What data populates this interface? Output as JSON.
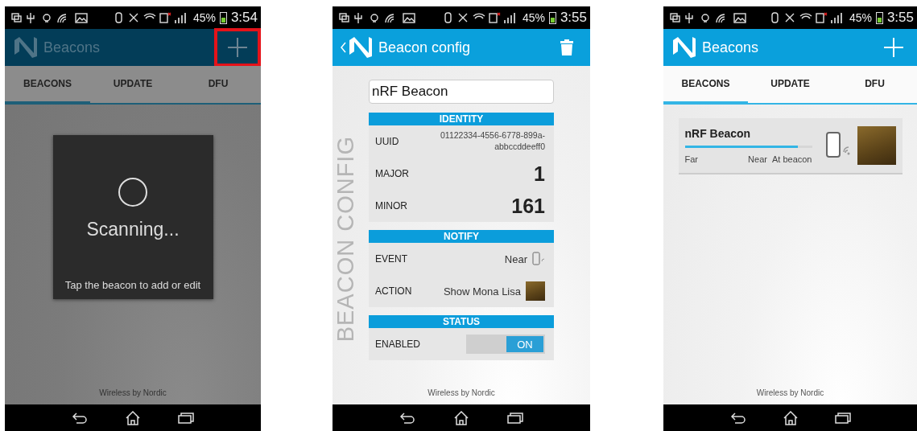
{
  "screens": [
    {
      "kind": "scanning",
      "dimmed": true,
      "status_bar": {
        "battery": "45%",
        "time": "3:54"
      },
      "app_bar": {
        "back": false,
        "title": "Beacons",
        "action": {
          "kind": "add",
          "highlighted": true
        }
      },
      "tabs": [
        {
          "label": "BEACONS",
          "selected": true
        },
        {
          "label": "UPDATE",
          "selected": false
        },
        {
          "label": "DFU",
          "selected": false
        }
      ],
      "dialog": {
        "title": "Scanning...",
        "message": "Tap the beacon to add or edit"
      },
      "footer": "Wireless by Nordic"
    },
    {
      "kind": "config",
      "dimmed": false,
      "status_bar": {
        "battery": "45%",
        "time": "3:55"
      },
      "app_bar": {
        "back": true,
        "title": "Beacon config",
        "action": {
          "kind": "delete",
          "highlighted": false
        }
      },
      "side_label": "BEACON CONFIG",
      "name_field": {
        "value": "nRF Beacon"
      },
      "sections": [
        {
          "title": "IDENTITY",
          "rows": [
            {
              "kind": "text",
              "label": "UUID",
              "value": "01122334-4556-6778-899a-abbccddeeff0"
            },
            {
              "kind": "number",
              "label": "MAJOR",
              "value": "1"
            },
            {
              "kind": "number",
              "label": "MINOR",
              "value": "161"
            }
          ]
        },
        {
          "title": "NOTIFY",
          "rows": [
            {
              "kind": "event",
              "label": "EVENT",
              "value": "Near"
            },
            {
              "kind": "action",
              "label": "ACTION",
              "value": "Show Mona Lisa"
            }
          ]
        },
        {
          "title": "STATUS",
          "rows": [
            {
              "kind": "toggle",
              "label": "ENABLED",
              "value": "ON",
              "on": true
            }
          ]
        }
      ],
      "footer": "Wireless by Nordic"
    },
    {
      "kind": "list",
      "dimmed": false,
      "status_bar": {
        "battery": "45%",
        "time": "3:55"
      },
      "app_bar": {
        "back": false,
        "title": "Beacons",
        "action": {
          "kind": "add",
          "highlighted": false
        }
      },
      "tabs": [
        {
          "label": "BEACONS",
          "selected": true
        },
        {
          "label": "UPDATE",
          "selected": false
        },
        {
          "label": "DFU",
          "selected": false
        }
      ],
      "beacons": [
        {
          "name": "nRF Beacon",
          "level": 0.89,
          "scale": [
            "Far",
            "Near",
            "At beacon"
          ]
        }
      ],
      "footer": "Wireless by Nordic"
    }
  ]
}
